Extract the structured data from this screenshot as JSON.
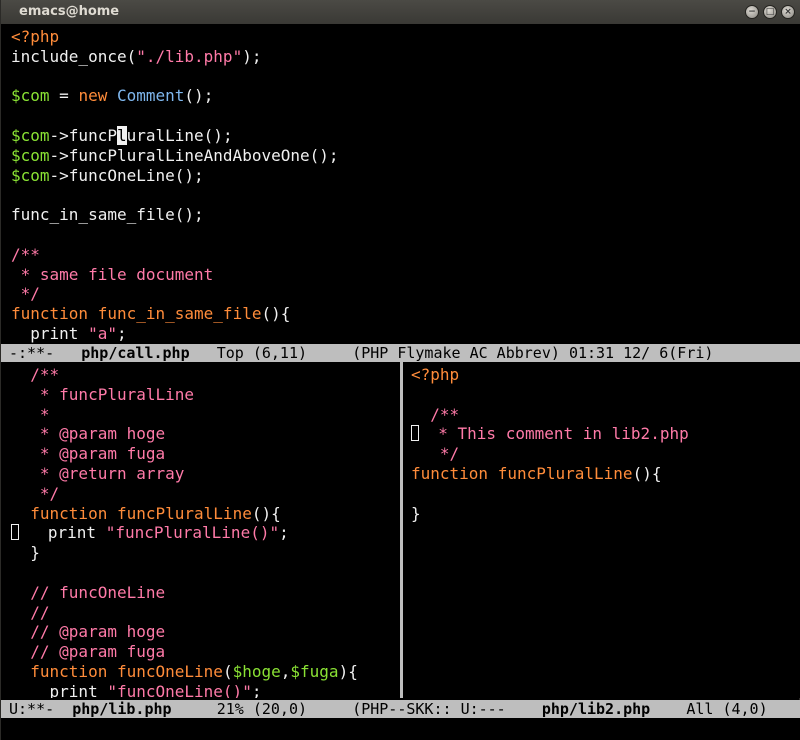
{
  "window": {
    "title": "emacs@home",
    "buttons": {
      "close": "×",
      "minimize": "−",
      "maximize": "□"
    }
  },
  "colors": {
    "keyword": "#ff8c3a",
    "comment": "#ff7aa8",
    "variable": "#8ae234",
    "type": "#7fb7ee",
    "text": "#f0f0f0",
    "modeline_bg": "#bebebe"
  },
  "top_pane": {
    "lines": [
      [
        [
          "kw",
          "<?php"
        ]
      ],
      [
        [
          "plain",
          "include_once("
        ],
        [
          "str",
          "\"./lib.php\""
        ],
        [
          "plain",
          ");"
        ]
      ],
      [],
      [
        [
          "var",
          "$com"
        ],
        [
          "plain",
          " = "
        ],
        [
          "kw",
          "new"
        ],
        [
          "plain",
          " "
        ],
        [
          "type",
          "Comment"
        ],
        [
          "plain",
          "();"
        ]
      ],
      [],
      [
        [
          "var",
          "$com"
        ],
        [
          "plain",
          "->funcP"
        ],
        [
          "cursor",
          "l"
        ],
        [
          "plain",
          "uralLine();"
        ]
      ],
      [
        [
          "var",
          "$com"
        ],
        [
          "plain",
          "->funcPluralLineAndAboveOne();"
        ]
      ],
      [
        [
          "var",
          "$com"
        ],
        [
          "plain",
          "->funcOneLine();"
        ]
      ],
      [],
      [
        [
          "plain",
          "func_in_same_file();"
        ]
      ],
      [],
      [
        [
          "com",
          "/**"
        ]
      ],
      [
        [
          "com",
          " * same file document"
        ]
      ],
      [
        [
          "com",
          " */"
        ]
      ],
      [
        [
          "kw",
          "function"
        ],
        [
          "plain",
          " "
        ],
        [
          "fn",
          "func_in_same_file"
        ],
        [
          "plain",
          "(){"
        ]
      ],
      [
        [
          "plain",
          "  print "
        ],
        [
          "str",
          "\"a\""
        ],
        [
          "plain",
          ";"
        ]
      ]
    ]
  },
  "modeline_top": {
    "status": "-:**-",
    "buffer": "php/call.php",
    "position": "Top (6,11)",
    "modes": "(PHP Flymake AC Abbrev)",
    "clock": "01:31 12/ 6(Fri)"
  },
  "left_pane": {
    "lines": [
      [
        [
          "plain",
          "  "
        ],
        [
          "com",
          "/**"
        ]
      ],
      [
        [
          "com",
          "   * funcPluralLine"
        ]
      ],
      [
        [
          "com",
          "   *"
        ]
      ],
      [
        [
          "com",
          "   * @param hoge"
        ]
      ],
      [
        [
          "com",
          "   * @param fuga"
        ]
      ],
      [
        [
          "com",
          "   * @return array"
        ]
      ],
      [
        [
          "com",
          "   */"
        ]
      ],
      [
        [
          "plain",
          "  "
        ],
        [
          "kw",
          "function"
        ],
        [
          "plain",
          " "
        ],
        [
          "fn",
          "funcPluralLine"
        ],
        [
          "plain",
          "(){"
        ]
      ],
      [
        [
          "hollow",
          ""
        ],
        [
          "plain",
          "   print "
        ],
        [
          "str",
          "\"funcPluralLine()\""
        ],
        [
          "plain",
          ";"
        ]
      ],
      [
        [
          "plain",
          "  }"
        ]
      ],
      [],
      [
        [
          "plain",
          "  "
        ],
        [
          "com",
          "// funcOneLine"
        ]
      ],
      [
        [
          "plain",
          "  "
        ],
        [
          "com",
          "//"
        ]
      ],
      [
        [
          "plain",
          "  "
        ],
        [
          "com",
          "// @param hoge"
        ]
      ],
      [
        [
          "plain",
          "  "
        ],
        [
          "com",
          "// @param fuga"
        ]
      ],
      [
        [
          "plain",
          "  "
        ],
        [
          "kw",
          "function"
        ],
        [
          "plain",
          " "
        ],
        [
          "fn",
          "funcOneLine"
        ],
        [
          "plain",
          "("
        ],
        [
          "var",
          "$hoge"
        ],
        [
          "plain",
          ","
        ],
        [
          "var",
          "$fuga"
        ],
        [
          "plain",
          "){"
        ]
      ],
      [
        [
          "plain",
          "    print "
        ],
        [
          "str",
          "\"funcOneLine()\""
        ],
        [
          "plain",
          ";"
        ]
      ]
    ]
  },
  "right_pane": {
    "lines": [
      [
        [
          "kw",
          "<?php"
        ]
      ],
      [],
      [
        [
          "plain",
          "  "
        ],
        [
          "com",
          "/**"
        ]
      ],
      [
        [
          "hollow",
          ""
        ],
        [
          "com",
          "  * This comment in lib2.php"
        ]
      ],
      [
        [
          "com",
          "   */"
        ]
      ],
      [
        [
          "kw",
          "function"
        ],
        [
          "plain",
          " "
        ],
        [
          "fn",
          "funcPluralLine"
        ],
        [
          "plain",
          "(){"
        ]
      ],
      [],
      [
        [
          "plain",
          "}"
        ]
      ]
    ]
  },
  "modeline_bottom": {
    "left_status": "U:**-",
    "left_buffer": "php/lib.php",
    "left_position": "21% (20,0)",
    "left_modes": "(PHP--SKK:: ",
    "right_status": "U:---",
    "right_buffer": "php/lib2.php",
    "right_position": "All (4,0)"
  }
}
